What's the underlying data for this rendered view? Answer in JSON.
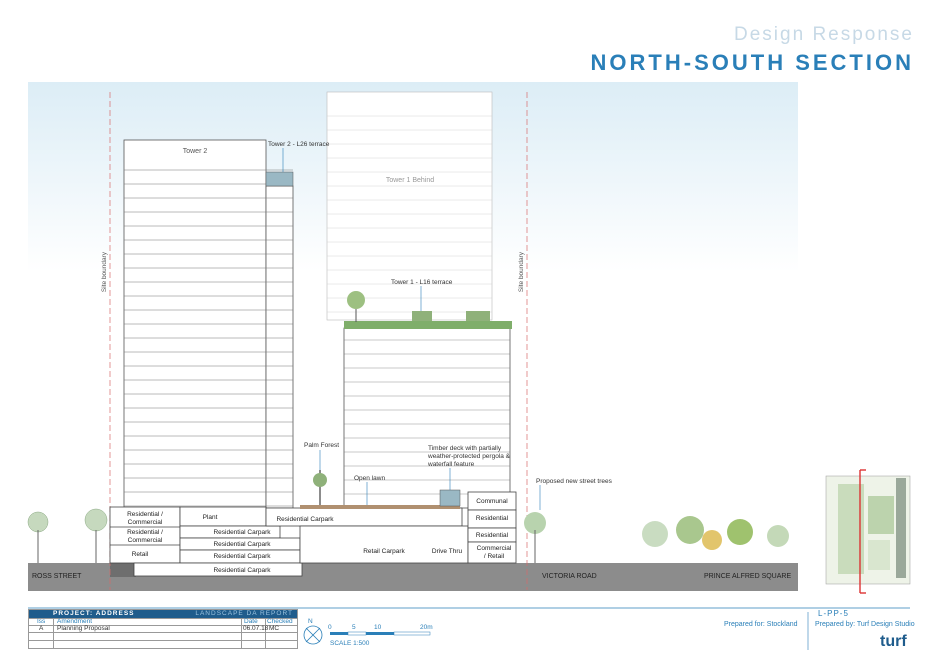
{
  "header": {
    "subtitle": "Design Response",
    "title": "NORTH-SOUTH SECTION"
  },
  "section": {
    "towers": {
      "tower2": "Tower 2",
      "tower1": "Tower 1 Behind"
    },
    "annotations": {
      "tower2_terrace": "Tower 2 - L26 terrace",
      "tower1_terrace": "Tower 1 - L16 terrace",
      "palm_forest": "Palm Forest",
      "open_lawn": "Open lawn",
      "timber_deck": [
        "Timber deck with partially",
        "weather-protected pergola &",
        "waterfall feature"
      ],
      "street_trees": "Proposed new street trees",
      "site_boundary": "Site boundary"
    },
    "podium": {
      "res_comm_1": [
        "Residential /",
        "Commercial"
      ],
      "res_comm_2": [
        "Residential /",
        "Commercial"
      ],
      "retail": "Retail",
      "plant": "Plant",
      "res_carpark_top": "Residential Carpark",
      "res_carpark_1": "Residential Carpark",
      "res_carpark_2": "Residential Carpark",
      "res_carpark_3": "Residential Carpark",
      "res_carpark_4": "Residential Carpark",
      "retail_carpark": "Retail Carpark",
      "drive_thru": "Drive Thru",
      "communal": "Communal",
      "residential_1": "Residential",
      "residential_2": "Residential",
      "commercial_retail": [
        "Commercial",
        "/ Retail"
      ]
    },
    "streets": {
      "ross": "ROSS STREET",
      "victoria": "VICTORIA ROAD",
      "prince_alfred": "PRINCE ALFRED SQUARE"
    }
  },
  "title_block": {
    "project": "PROJECT: ADDRESS",
    "report": "LANDSCAPE DA REPORT",
    "col_iss": "Iss",
    "col_amendment": "Amendment",
    "col_date": "Date",
    "col_checked": "Checked",
    "row_iss": "A",
    "row_amendment": "Planning Proposal",
    "row_date": "06.07.18",
    "row_checked": "MC"
  },
  "scale": {
    "north": "N",
    "ticks": [
      "0",
      "5",
      "10",
      "20m"
    ],
    "label": "SCALE 1:500"
  },
  "footer": {
    "sheet": "L-PP-5",
    "prepared_for": "Prepared for: Stockland",
    "prepared_by": "Prepared by: Turf Design Studio",
    "logo": "turf"
  },
  "colors": {
    "accent": "#2a7fb8",
    "sky": "#e8f4fa",
    "ground": "#8a8a8a"
  }
}
